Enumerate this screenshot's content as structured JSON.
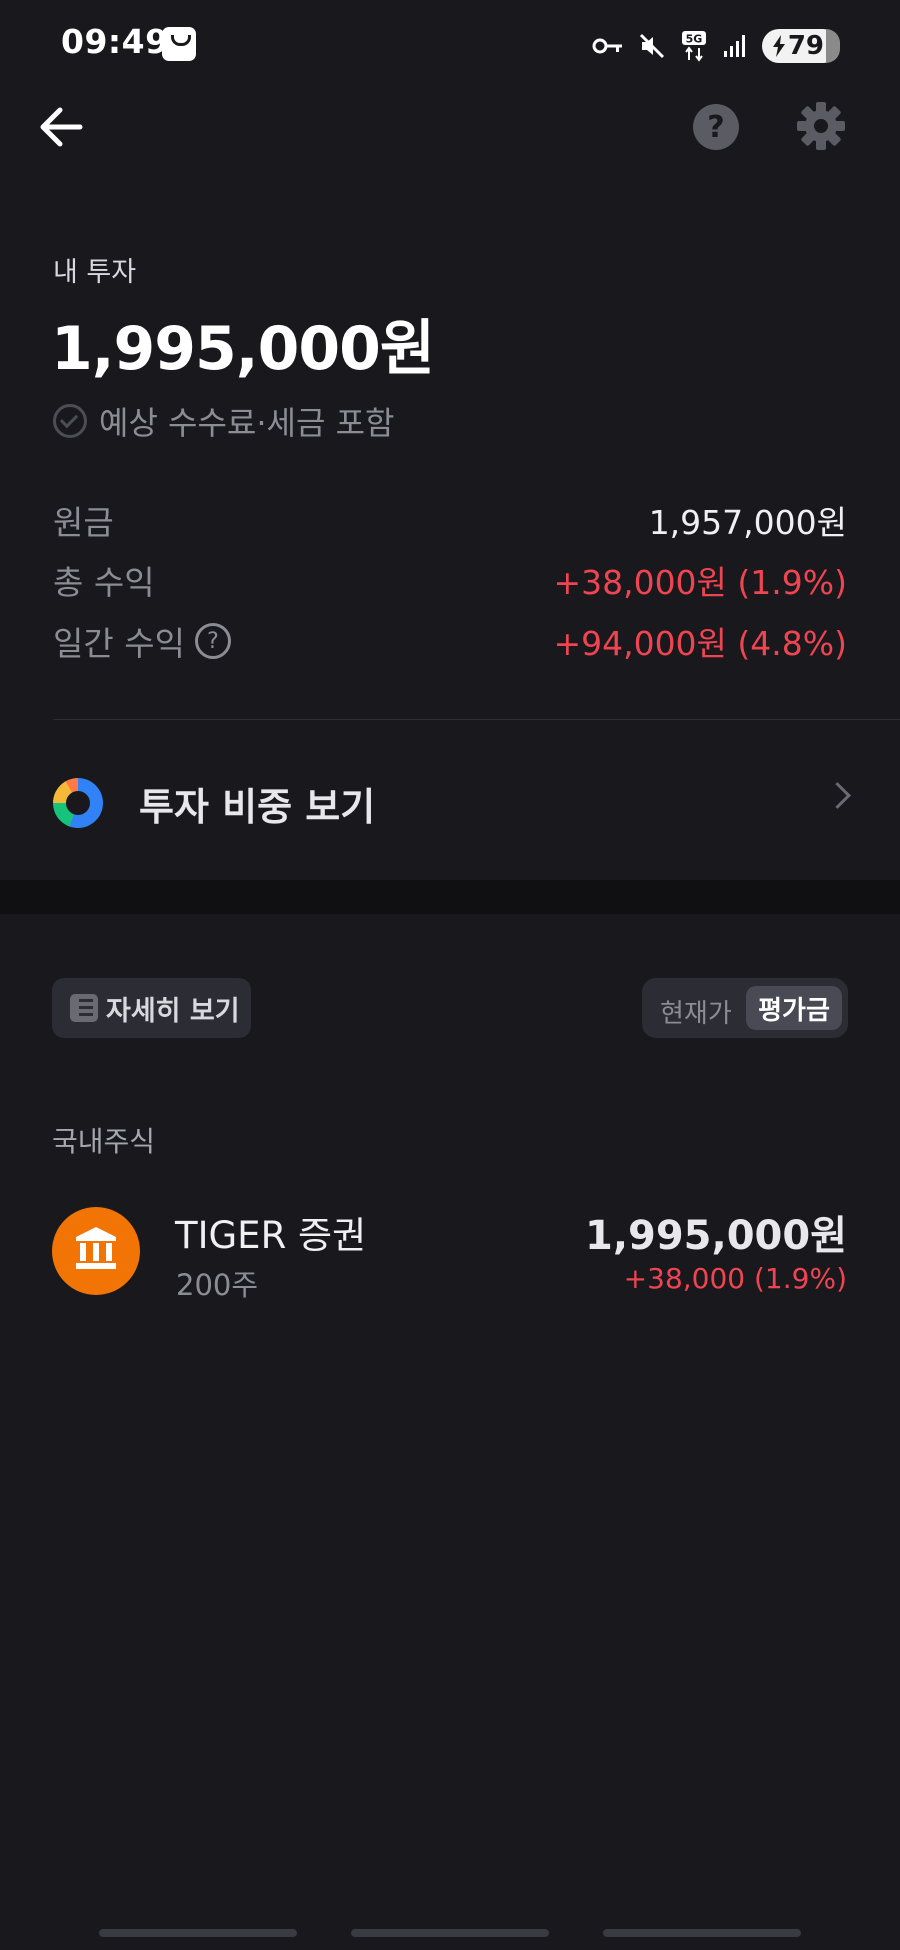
{
  "status_bar": {
    "time": "09:49",
    "battery": "79"
  },
  "header": {
    "help_glyph": "?"
  },
  "summary": {
    "label": "내 투자",
    "total": "1,995,000원",
    "fee_note": "예상 수수료·세금 포함",
    "rows": [
      {
        "label": "원금",
        "value": "1,957,000원",
        "color": "#f0f0f2"
      },
      {
        "label": "총 수익",
        "value": "+38,000원 (1.9%)",
        "color": "#ef4452"
      },
      {
        "label": "일간 수익",
        "value": "+94,000원 (4.8%)",
        "color": "#ef4452"
      }
    ]
  },
  "weight": {
    "label": "투자 비중 보기"
  },
  "controls": {
    "detail_label": "자세히 보기",
    "toggle_current": "현재가",
    "toggle_average": "평가금"
  },
  "section_title": "국내주식",
  "holdings": [
    {
      "name": "TIGER 증권",
      "qty": "200주",
      "value": "1,995,000원",
      "change": "+38,000 (1.9%)",
      "icon": "bank-icon",
      "icon_color": "#f27405"
    }
  ]
}
